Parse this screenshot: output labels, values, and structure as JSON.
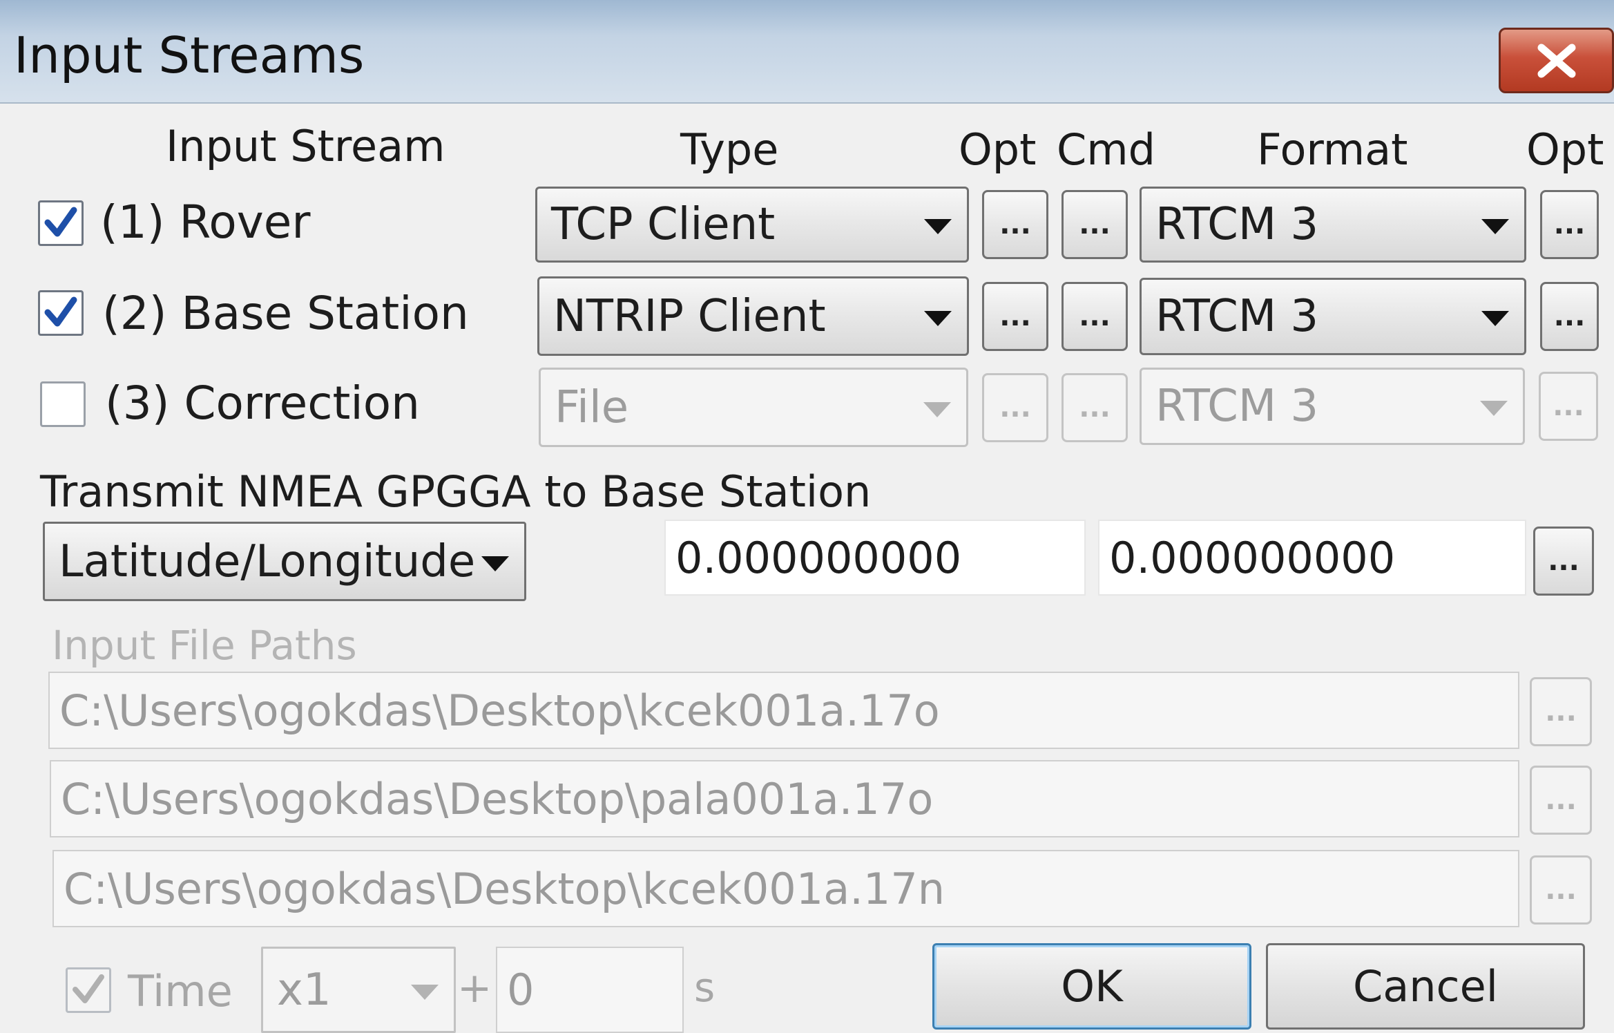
{
  "window": {
    "title": "Input Streams",
    "close_label": "X"
  },
  "headers": {
    "input_stream": "Input Stream",
    "type": "Type",
    "opt": "Opt",
    "cmd": "Cmd",
    "format": "Format",
    "opt2": "Opt"
  },
  "streams": [
    {
      "checked": true,
      "enabled": true,
      "label": "(1) Rover",
      "type": "TCP Client",
      "format": "RTCM 3"
    },
    {
      "checked": true,
      "enabled": true,
      "label": "(2) Base Station",
      "type": "NTRIP Client",
      "format": "RTCM 3"
    },
    {
      "checked": false,
      "enabled": false,
      "label": "(3) Correction",
      "type": "File",
      "format": "RTCM 3"
    }
  ],
  "ellipsis": "...",
  "nmea": {
    "title": "Transmit NMEA GPGGA to Base Station",
    "mode": "Latitude/Longitude",
    "lat": "0.000000000",
    "lon": "0.000000000"
  },
  "file_paths": {
    "title": "Input File Paths",
    "paths": [
      "C:\\Users\\ogokdas\\Desktop\\kcek001a.17o",
      "C:\\Users\\ogokdas\\Desktop\\pala001a.17o",
      "C:\\Users\\ogokdas\\Desktop\\kcek001a.17n"
    ]
  },
  "footer": {
    "time_label": "Time",
    "time_checked": true,
    "speed": "x1",
    "plus": "+",
    "offset": "0",
    "unit": "s",
    "ok": "OK",
    "cancel": "Cancel"
  }
}
